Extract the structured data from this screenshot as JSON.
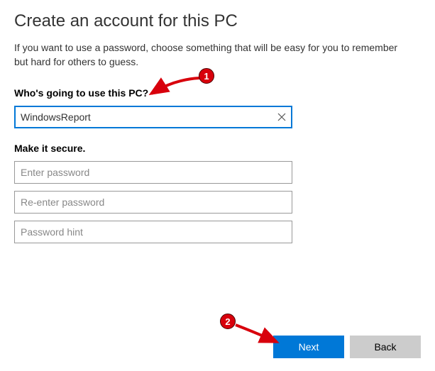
{
  "heading": "Create an account for this PC",
  "description": "If you want to use a password, choose something that will be easy for you to remember but hard for others to guess.",
  "user_section": {
    "label": "Who's going to use this PC?",
    "username_value": "WindowsReport"
  },
  "secure_section": {
    "label": "Make it secure.",
    "password_placeholder": "Enter password",
    "reenter_placeholder": "Re-enter password",
    "hint_placeholder": "Password hint"
  },
  "buttons": {
    "next": "Next",
    "back": "Back"
  },
  "annotations": {
    "marker1": "1",
    "marker2": "2"
  }
}
